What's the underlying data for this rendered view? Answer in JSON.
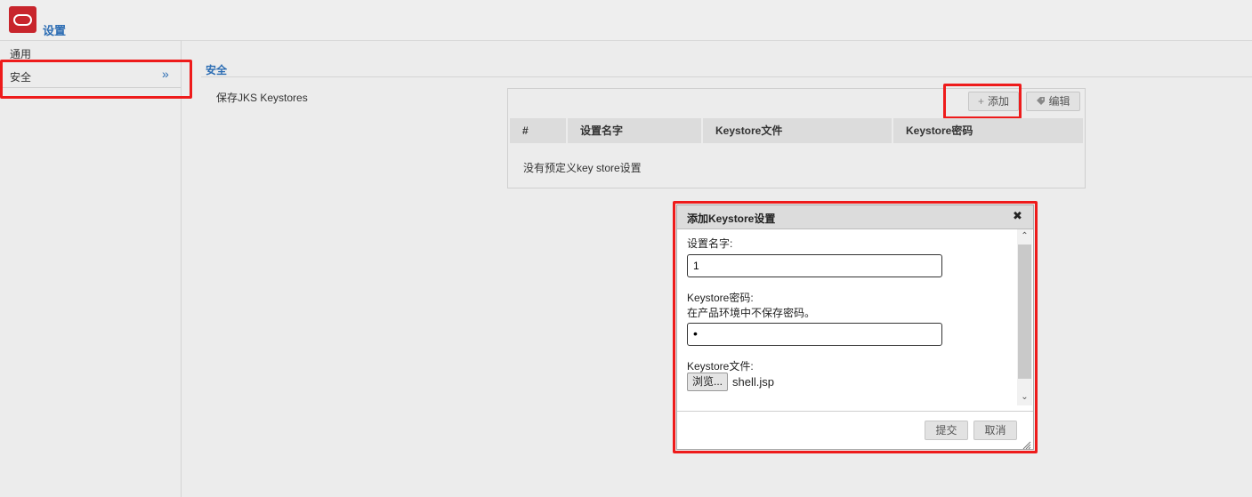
{
  "app": {
    "title": "设置"
  },
  "sidebar": {
    "items": [
      {
        "label": "通用"
      },
      {
        "label": "安全",
        "arrow": "»"
      }
    ]
  },
  "section": {
    "title": "安全",
    "keystores_label": "保存JKS Keystores"
  },
  "toolbar": {
    "add_icon": "+",
    "add_label": "添加",
    "edit_label": "编辑"
  },
  "table": {
    "columns": [
      "#",
      "设置名字",
      "Keystore文件",
      "Keystore密码"
    ],
    "empty_message": "没有预定义key store设置"
  },
  "dialog": {
    "title": "添加Keystore设置",
    "close_glyph": "✖",
    "name_label": "设置名字:",
    "name_value": "1",
    "password_label": "Keystore密码:",
    "password_note": "在产品环境中不保存密码。",
    "password_value": "•",
    "file_label": "Keystore文件:",
    "browse_label": "浏览...",
    "file_name": "shell.jsp",
    "submit_label": "提交",
    "cancel_label": "取消"
  },
  "colors": {
    "accent": "#2b6cb3",
    "logo": "#c8252c",
    "highlight": "#ee1b1b"
  }
}
